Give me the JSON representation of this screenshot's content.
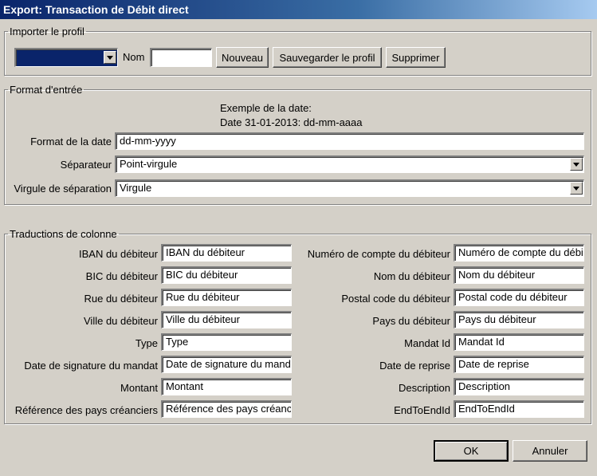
{
  "window": {
    "title": "Export: Transaction de Débit direct"
  },
  "profile": {
    "legend": "Importer le profil",
    "selected": "",
    "name_label": "Nom",
    "name_value": "",
    "btn_new": "Nouveau",
    "btn_save": "Sauvegarder le profil",
    "btn_delete": "Supprimer"
  },
  "input_format": {
    "legend": "Format d'entrée",
    "example_line1": "Exemple de la date:",
    "example_line2": "Date 31-01-2013: dd-mm-aaaa",
    "date_format_label": "Format de la date",
    "date_format_value": "dd-mm-yyyy",
    "separator_label": "Séparateur",
    "separator_value": "Point-virgule",
    "decimal_label": "Virgule de séparation",
    "decimal_value": "Virgule"
  },
  "translations": {
    "legend": "Traductions de colonne",
    "left": [
      {
        "label": "IBAN du débiteur",
        "value": "IBAN du débiteur"
      },
      {
        "label": "BIC du débiteur",
        "value": "BIC du débiteur"
      },
      {
        "label": "Rue du débiteur",
        "value": "Rue du débiteur"
      },
      {
        "label": "Ville du débiteur",
        "value": "Ville du débiteur"
      },
      {
        "label": "Type",
        "value": "Type"
      },
      {
        "label": "Date de signature du mandat",
        "value": "Date de signature du mandat"
      },
      {
        "label": "Montant",
        "value": "Montant"
      },
      {
        "label": "Référence des pays créanciers",
        "value": "Référence des pays créanciers"
      }
    ],
    "right": [
      {
        "label": "Numéro de compte du débiteur",
        "value": "Numéro de compte du débiteur"
      },
      {
        "label": "Nom du débiteur",
        "value": "Nom du débiteur"
      },
      {
        "label": "Postal code du débiteur",
        "value": "Postal code du débiteur"
      },
      {
        "label": "Pays du débiteur",
        "value": "Pays du débiteur"
      },
      {
        "label": "Mandat Id",
        "value": "Mandat Id"
      },
      {
        "label": "Date de reprise",
        "value": "Date de reprise"
      },
      {
        "label": "Description",
        "value": "Description"
      },
      {
        "label": "EndToEndId",
        "value": "EndToEndId"
      }
    ]
  },
  "footer": {
    "ok": "OK",
    "cancel": "Annuler"
  }
}
